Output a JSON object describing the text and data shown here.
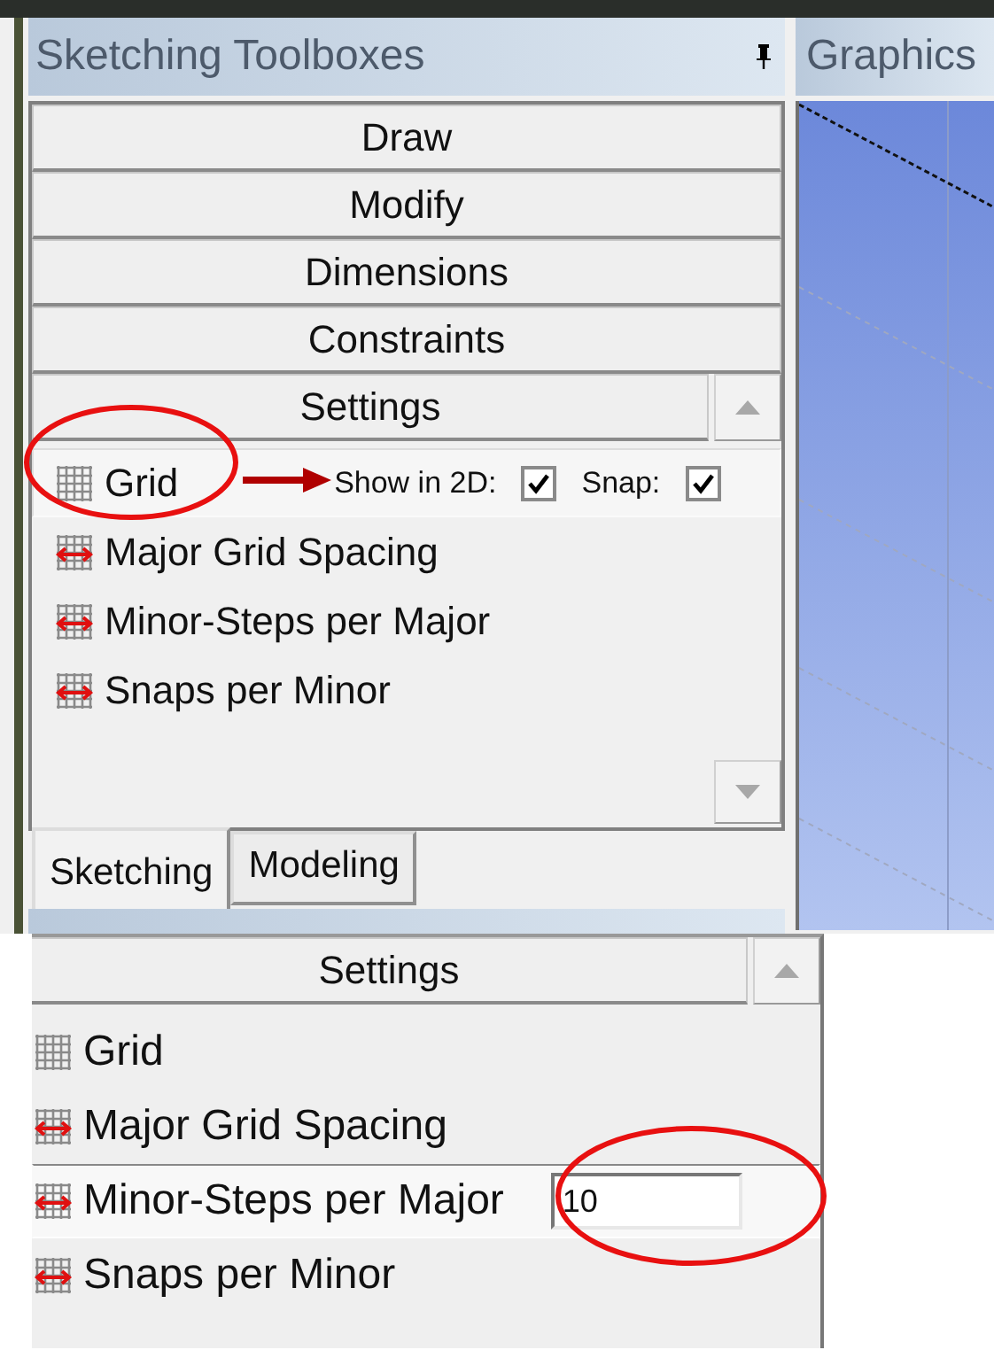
{
  "toolbox_panel": {
    "title": "Sketching Toolboxes",
    "toolboxes": [
      {
        "label": "Draw"
      },
      {
        "label": "Modify"
      },
      {
        "label": "Dimensions"
      },
      {
        "label": "Constraints"
      }
    ],
    "settings": {
      "header": "Settings",
      "items": [
        {
          "label": "Grid",
          "kind": "grid",
          "selected": true,
          "show_label": "Show in 2D:",
          "show_checked": true,
          "snap_label": "Snap:",
          "snap_checked": true
        },
        {
          "label": "Major Grid Spacing",
          "kind": "spacing",
          "selected": false
        },
        {
          "label": "Minor-Steps per Major",
          "kind": "spacing",
          "selected": false
        },
        {
          "label": "Snaps per Minor",
          "kind": "spacing",
          "selected": false
        }
      ]
    },
    "tabs": [
      {
        "label": "Sketching",
        "selected": true
      },
      {
        "label": "Modeling",
        "selected": false
      }
    ]
  },
  "graphics_panel": {
    "title": "Graphics"
  },
  "detail_panel": {
    "header": "Settings",
    "items": [
      {
        "label": "Grid",
        "kind": "grid",
        "selected": false
      },
      {
        "label": "Major Grid Spacing",
        "kind": "spacing",
        "selected": false
      },
      {
        "label": "Minor-Steps per Major",
        "kind": "spacing",
        "selected": true,
        "value": "10"
      },
      {
        "label": "Snaps per Minor",
        "kind": "spacing",
        "selected": false
      }
    ]
  }
}
